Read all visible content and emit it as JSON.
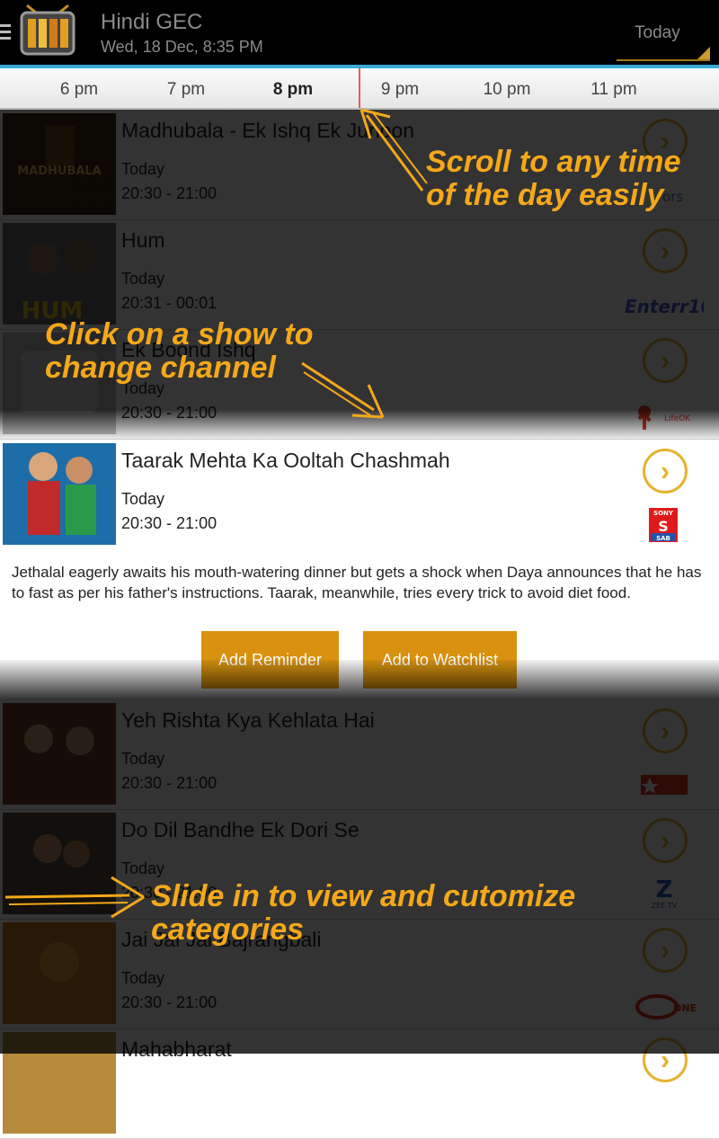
{
  "header": {
    "title": "Hindi GEC",
    "subtitle": "Wed, 18 Dec, 8:35 PM",
    "day_selector": "Today"
  },
  "timeline": {
    "ticks": [
      "6 pm",
      "7 pm",
      "8 pm",
      "9 pm",
      "10 pm",
      "11 pm"
    ],
    "current": "8 pm"
  },
  "shows": [
    {
      "title": "Madhubala - Ek Ishq Ek Junoon",
      "day": "Today",
      "time": "20:30 - 21:00",
      "channel": "Colors",
      "thumb_text": "MADHUBALA"
    },
    {
      "title": "Hum",
      "day": "Today",
      "time": "20:31 - 00:01",
      "channel": "Enterr10",
      "thumb_text": "HUM"
    },
    {
      "title": "Ek Boond Ishq",
      "day": "Today",
      "time": "20:30 - 21:00",
      "channel": "Life OK",
      "thumb_text": ""
    },
    {
      "title": "Taarak Mehta Ka Ooltah Chashmah",
      "day": "Today",
      "time": "20:30 - 21:00",
      "channel": "Sony SAB",
      "thumb_text": ""
    },
    {
      "title": "Yeh Rishta Kya Kehlata Hai",
      "day": "Today",
      "time": "20:30 - 21:00",
      "channel": "Star Plus",
      "thumb_text": ""
    },
    {
      "title": "Do Dil Bandhe Ek Dori Se",
      "day": "Today",
      "time": "20:30 - 21:00",
      "channel": "Zee TV",
      "thumb_text": ""
    },
    {
      "title": "Jai Jai Jai Bajrangbali",
      "day": "Today",
      "time": "20:30 - 21:00",
      "channel": "Sahara One",
      "thumb_text": ""
    },
    {
      "title": "Mahabharat",
      "day": "",
      "time": "",
      "channel": "",
      "thumb_text": ""
    }
  ],
  "detail": {
    "description": "Jethalal eagerly awaits his mouth-watering dinner but gets a shock when Daya announces that he has to fast as per his father's instructions. Taarak, meanwhile, tries every trick to avoid diet food.",
    "add_reminder_label": "Add Reminder",
    "add_watchlist_label": "Add to Watchlist"
  },
  "channel_logos": {
    "colors": "ors",
    "enterr10": "Enterr10",
    "lifeok": "LifeOK",
    "sony_top": "SONY",
    "sony_bottom": "SAB",
    "zee_sub": "ZEE TV",
    "sahara": "ONE"
  },
  "hints": {
    "scroll": [
      "Scroll to any time",
      "of the day easily"
    ],
    "click": [
      "Click on a show to",
      "change channel"
    ],
    "slide": [
      "Slide in to view and cutomize",
      "categories"
    ]
  },
  "colors": {
    "accent": "#e6b32f",
    "button": "#d8920f",
    "hint": "#f4a81a",
    "header_bg": "#000000",
    "header_rule": "#39a9d8",
    "time_marker": "#e35b5b"
  }
}
